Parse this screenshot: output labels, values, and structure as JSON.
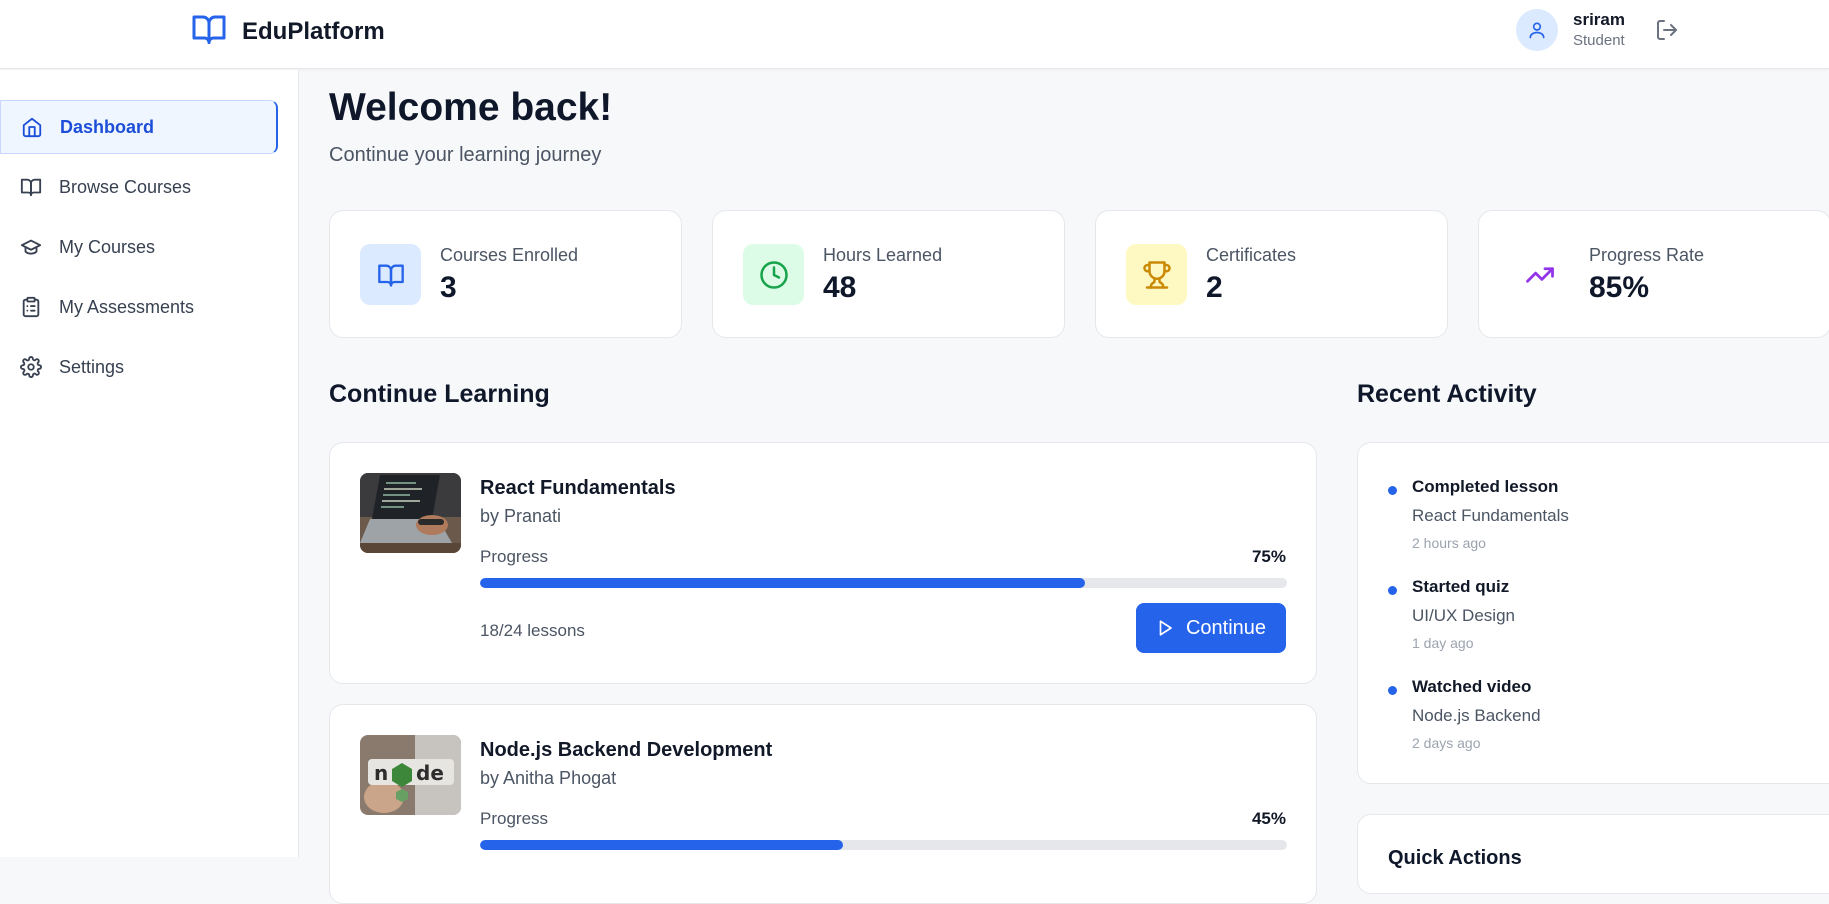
{
  "header": {
    "brand": "EduPlatform",
    "user_name": "sriram",
    "user_role": "Student"
  },
  "sidebar": {
    "items": [
      {
        "label": "Dashboard",
        "icon": "home-icon",
        "active": true
      },
      {
        "label": "Browse Courses",
        "icon": "book-open-icon",
        "active": false
      },
      {
        "label": "My Courses",
        "icon": "graduation-cap-icon",
        "active": false
      },
      {
        "label": "My Assessments",
        "icon": "clipboard-list-icon",
        "active": false
      },
      {
        "label": "Settings",
        "icon": "gear-icon",
        "active": false
      }
    ]
  },
  "main": {
    "welcome_title": "Welcome back!",
    "welcome_subtitle": "Continue your learning journey"
  },
  "stats": [
    {
      "label": "Courses Enrolled",
      "value": "3",
      "icon": "book-open-icon",
      "icon_bg": "#dbeafe",
      "icon_color": "#2563eb"
    },
    {
      "label": "Hours Learned",
      "value": "48",
      "icon": "clock-icon",
      "icon_bg": "#dcfce7",
      "icon_color": "#16a34a"
    },
    {
      "label": "Certificates",
      "value": "2",
      "icon": "trophy-icon",
      "icon_bg": "#fef9c3",
      "icon_color": "#ca8a04"
    },
    {
      "label": "Progress Rate",
      "value": "85%",
      "icon": "trending-up-icon",
      "icon_bg": "#ffffff",
      "icon_color": "#9333ea"
    }
  ],
  "continue_learning": {
    "title": "Continue Learning",
    "progress_label": "Progress",
    "button_label": "Continue",
    "courses": [
      {
        "title": "React Fundamentals",
        "author": "by Pranati",
        "progress": 75,
        "progress_text": "75%",
        "lessons": "18/24 lessons"
      },
      {
        "title": "Node.js Backend Development",
        "author": "by Anitha Phogat",
        "progress": 45,
        "progress_text": "45%"
      }
    ]
  },
  "recent_activity": {
    "title": "Recent Activity",
    "items": [
      {
        "action": "Completed lesson",
        "course": "React Fundamentals",
        "time": "2 hours ago"
      },
      {
        "action": "Started quiz",
        "course": "UI/UX Design",
        "time": "1 day ago"
      },
      {
        "action": "Watched video",
        "course": "Node.js Backend",
        "time": "2 days ago"
      }
    ]
  },
  "quick_actions": {
    "title": "Quick Actions"
  },
  "colors": {
    "accent": "#2563eb",
    "progress_track": "#e5e7eb"
  }
}
